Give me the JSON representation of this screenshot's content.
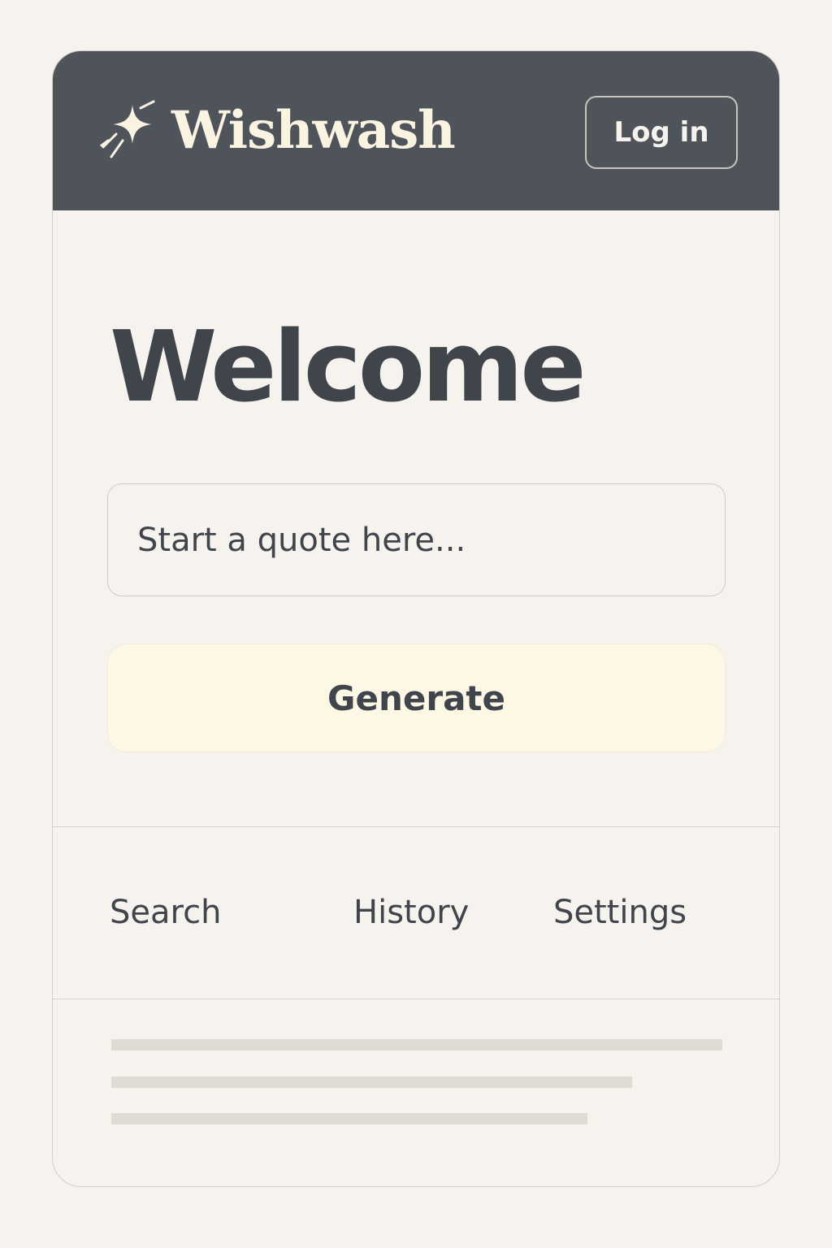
{
  "header": {
    "brand_name": "Wishwash",
    "brand_icon": "sparkle-icon",
    "login_label": "Log in"
  },
  "main": {
    "title": "Welcome",
    "quote_input": {
      "placeholder": "Start a quote here...",
      "value": ""
    },
    "generate_label": "Generate"
  },
  "nav": {
    "items": [
      {
        "label": "Search"
      },
      {
        "label": "History"
      },
      {
        "label": "Settings"
      }
    ]
  },
  "colors": {
    "header_bg": "#4f545b",
    "page_bg": "#f6f3ee",
    "accent_button_bg": "#fdf7e6",
    "text": "#40454c",
    "brand_text": "#fbf3e2"
  }
}
